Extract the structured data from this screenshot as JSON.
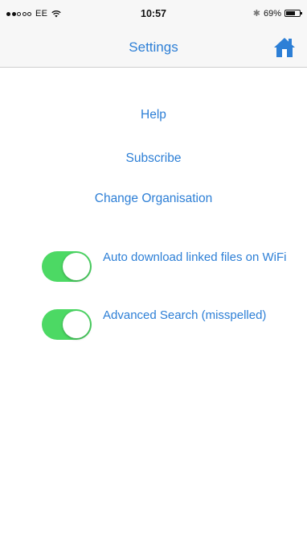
{
  "status_bar": {
    "carrier": "EE",
    "time": "10:57",
    "battery_text": "69%",
    "battery_level": 0.69,
    "signal_bars_filled": 2,
    "signal_bars_total": 5
  },
  "nav": {
    "title": "Settings",
    "home_icon": "home-icon"
  },
  "links": {
    "help": "Help",
    "subscribe": "Subscribe",
    "change_organisation": "Change Organisation"
  },
  "toggles": [
    {
      "label": "Auto download linked files on WiFi",
      "on": true
    },
    {
      "label": "Advanced Search (misspelled)",
      "on": true
    }
  ],
  "colors": {
    "accent": "#2d7fd6",
    "toggle_on": "#4cd964"
  }
}
